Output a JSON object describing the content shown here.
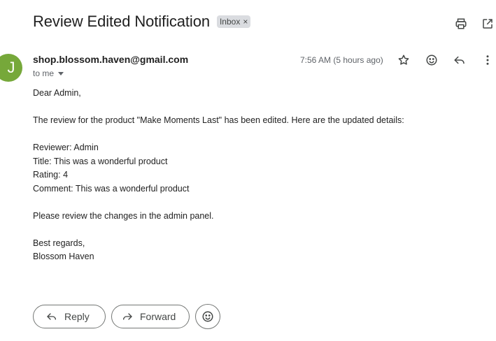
{
  "email": {
    "subject": "Review Edited Notification",
    "label": "Inbox",
    "label_close": "×",
    "sender": "shop.blossom.haven@gmail.com",
    "avatar_letter": "J",
    "avatar_color": "#76a83a",
    "recipient": "to me",
    "timestamp": "7:56 AM (5 hours ago)",
    "body": {
      "greeting": "Dear Admin,",
      "intro": "The review for the product \"Make Moments Last\" has been edited. Here are the updated details:",
      "reviewer": "Reviewer: Admin",
      "title": "Title: This was a wonderful product",
      "rating": "Rating: 4",
      "comment": "Comment: This was a wonderful product",
      "instruction": "Please review the changes in the admin panel.",
      "closing": "Best regards,",
      "signature": "Blossom Haven"
    }
  },
  "toolbar": {
    "icons": [
      "print-icon",
      "open-in-new-window-icon"
    ]
  },
  "message_actions": {
    "icons": [
      "star-icon",
      "emoji-icon",
      "reply-icon",
      "more-vert-icon"
    ]
  },
  "footer_actions": {
    "reply_label": "Reply",
    "forward_label": "Forward"
  }
}
